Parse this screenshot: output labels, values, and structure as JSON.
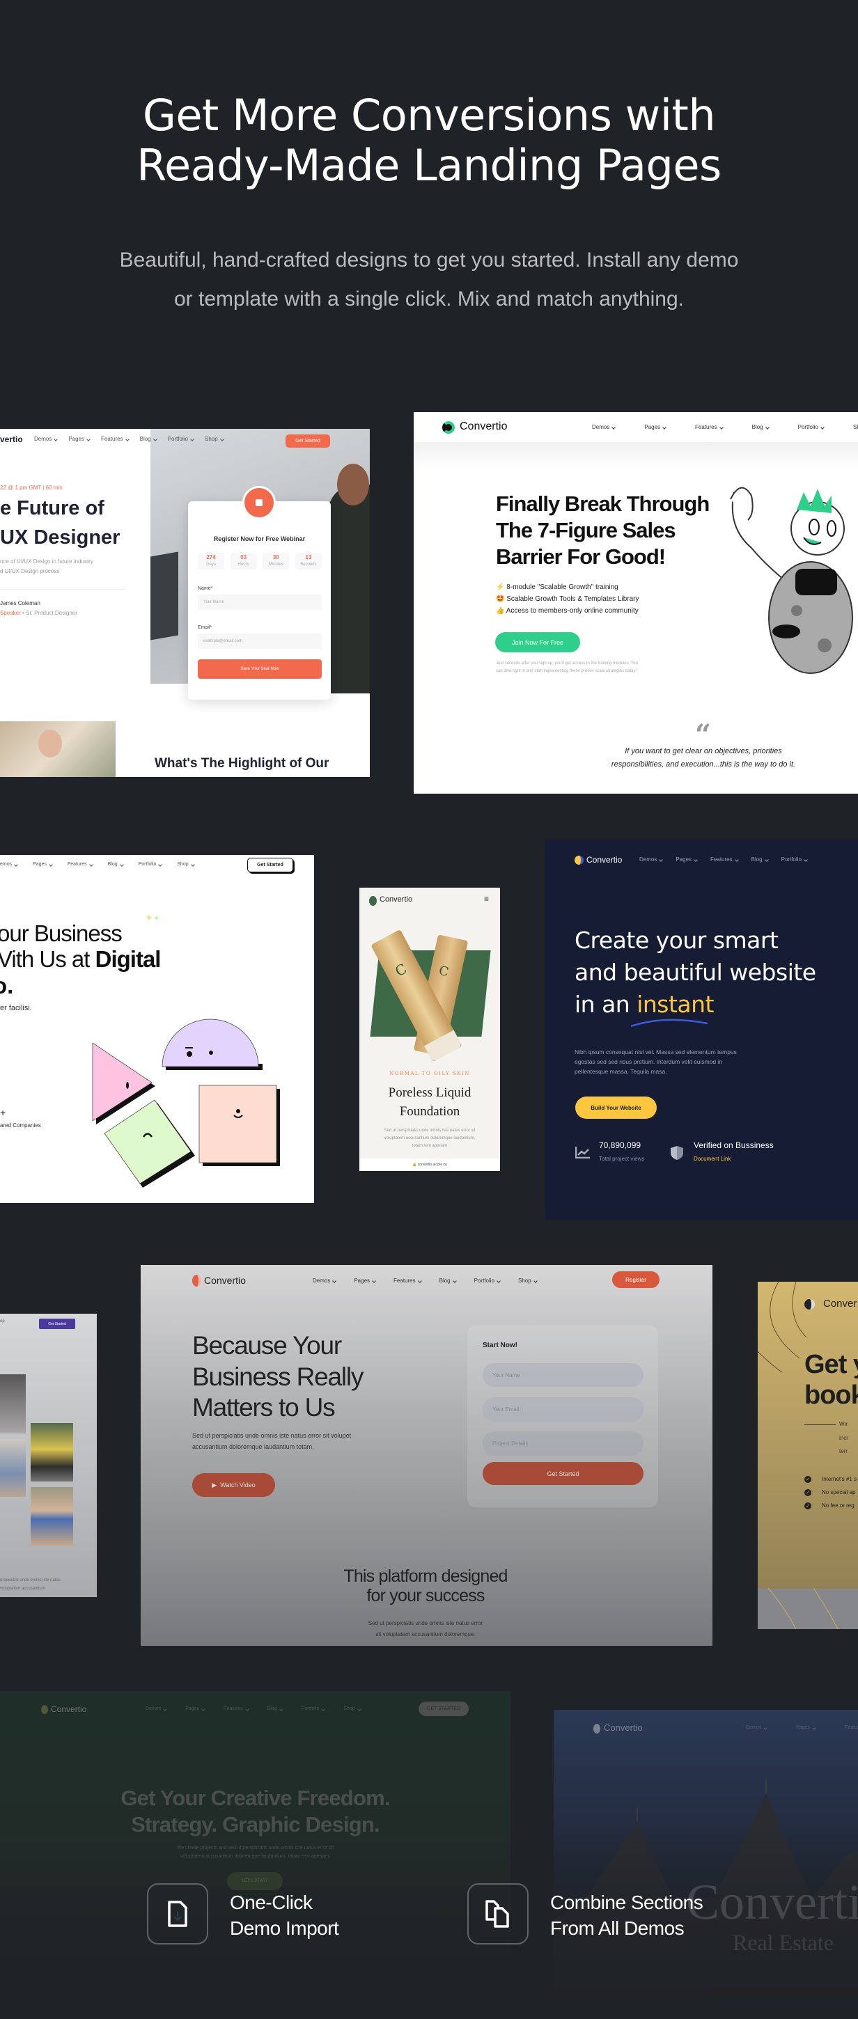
{
  "hero": {
    "title_line1": "Get More Conversions with",
    "title_line2": "Ready-Made Landing Pages",
    "subtitle_line1": "Beautiful, hand-crafted designs to get you started. Install any demo",
    "subtitle_line2": "or template with a single click. Mix and match anything."
  },
  "webinar": {
    "logo": "vertio",
    "nav": [
      "Demos",
      "Pages",
      "Features",
      "Blog",
      "Portfolio",
      "Shop"
    ],
    "cta": "Get Started",
    "date": "22 @ 1 pm GMT | 60 min",
    "title1": "e Future of",
    "title2": "UX Designer",
    "desc1": "nce of UI/UX Design in future industry",
    "desc2": "d UI/UX Design process",
    "speaker": "James Coleman",
    "speaker_tag": "Speaker",
    "speaker_role": "Sr. Product Designer",
    "form": {
      "title": "Register Now for Free Webinar",
      "countdown": [
        {
          "value": "274",
          "label": "Days"
        },
        {
          "value": "03",
          "label": "Hours"
        },
        {
          "value": "30",
          "label": "Minutes"
        },
        {
          "value": "13",
          "label": "Seconds"
        }
      ],
      "name_label": "Name*",
      "name_placeholder": "Your Name",
      "email_label": "Email*",
      "email_placeholder": "example@email.com",
      "submit": "Save Your Seat Now"
    },
    "section_title": "What's The Highlight of Our",
    "accent": "#f26a4b"
  },
  "sales": {
    "logo": "Convertio",
    "nav": [
      "Demos",
      "Pages",
      "Features",
      "Blog",
      "Portfolio",
      "Shop"
    ],
    "title1": "Finally Break Through",
    "title2": "The 7-Figure Sales",
    "title3": "Barrier For Good!",
    "bullets": [
      {
        "emoji": "⚡",
        "text": "8-module \"Scalable Growth\" training"
      },
      {
        "emoji": "🤩",
        "text": "Scalable Growth Tools & Templates Library"
      },
      {
        "emoji": "👍",
        "text": "Access to members-only online community"
      }
    ],
    "cta": "Join Now For Free",
    "note1": "Just seconds after you sign up, you'll get access to the training modules. You",
    "note2": "can dive right in and start implementing these proven scale strategies today!",
    "quote_line1": "If you want to get clear on objectives, priorities",
    "quote_line2": "responsibilities, and execution...this is the way to do it.",
    "accent": "#2ecf8a"
  },
  "agency": {
    "nav": [
      "emos",
      "Pages",
      "Features",
      "Blog",
      "Portfolio",
      "Shop"
    ],
    "cta": "Get Started",
    "title1": "our Business",
    "title2a": "Vith Us at ",
    "title2b": "Digital",
    "title3": "o.",
    "desc": "er facilisi.",
    "stat": "+",
    "stat_label": "ared Companies"
  },
  "mobile": {
    "logo": "Convertio",
    "tag": "NORMAL TO OILY SKIN",
    "title1": "Poreless Liquid",
    "title2": "Foundation",
    "desc1": "Sed ut perspiciatis unde omnis iste natus error sit",
    "desc2": "voluptatem accusantium doloremque laudantium,",
    "desc3": "totam rem aperiam",
    "url": "convertio.uicore.co"
  },
  "builder": {
    "logo": "Convertio",
    "nav": [
      "Demos",
      "Pages",
      "Features",
      "Blog",
      "Portfolio"
    ],
    "title1": "Create your smart",
    "title2": "and beautiful website",
    "title3a": "in an ",
    "title3b": "instant",
    "desc1": "Nibh ipsum consequat nisl vel. Massa sed elementum tempus",
    "desc2": "egestas sed sed risus pretium. Interdum velit euismod in",
    "desc3": "pellentesque massa. Tequila masa.",
    "cta": "Build Your Website",
    "stat_value": "70,890,099",
    "stat_label": "Total project views",
    "verified": "Verified on Bussiness",
    "doc_link": "Document Link",
    "accent": "#fcc73f"
  },
  "fitness": {
    "nav": [
      "op"
    ],
    "cta": "Get Started",
    "text1": "erspiciatis unde omnis iste natus",
    "text2": "voluptatem accusantium"
  },
  "business": {
    "logo": "Convertio",
    "nav": [
      "Demos",
      "Pages",
      "Features",
      "Blog",
      "Portfolio",
      "Shop"
    ],
    "cta": "Register",
    "title1": "Because Your",
    "title2": "Business Really",
    "title3": "Matters to Us",
    "desc1": "Sed ut perspiciatis unde omnis iste natus error sit volupet",
    "desc2": "accusantium doloremque laudantium totam.",
    "video": "Watch Video",
    "form_title": "Start Now!",
    "name_placeholder": "Your Name",
    "email_placeholder": "Your Email",
    "details_placeholder": "Project Details",
    "submit": "Get Started",
    "section1": "This platform designed",
    "section2": "for your success",
    "section_desc1": "Sed ut perspiciatis unde omnis iste natus error",
    "section_desc2": "sit voluptatem accusantium doloremque.",
    "accent": "#a84a38"
  },
  "book": {
    "logo": "Conver",
    "title1": "Get y",
    "title2": "book",
    "text1": "Wir",
    "text2": "incr",
    "text3": "terr",
    "checks": [
      "Internet's #1 s",
      "No special ap",
      "No fee or reg"
    ]
  },
  "creative": {
    "logo": "Convertio",
    "nav": [
      "Demos",
      "Pages",
      "Features",
      "Blog",
      "Portfolio",
      "Shop"
    ],
    "cta": "GET STARTED",
    "title1": "Get Your Creative Freedom.",
    "title2": "Strategy. Graphic Design.",
    "desc1": "We create projects and sed ut perspiciatis unde omnis iste natus error sit",
    "desc2": "voluptatem accusantium doloremque laudantium, totam rem aperiam.",
    "start": "LET'S START"
  },
  "realestate": {
    "logo": "Convertio",
    "nav": [
      "Demos",
      "Pages",
      "Features"
    ],
    "big": "Converti",
    "sub": "Real Estate"
  },
  "features": [
    {
      "line1": "One-Click",
      "line2": "Demo Import",
      "icon": "file-import-icon"
    },
    {
      "line1": "Combine Sections",
      "line2": "From All Demos",
      "icon": "copy-files-icon"
    }
  ]
}
